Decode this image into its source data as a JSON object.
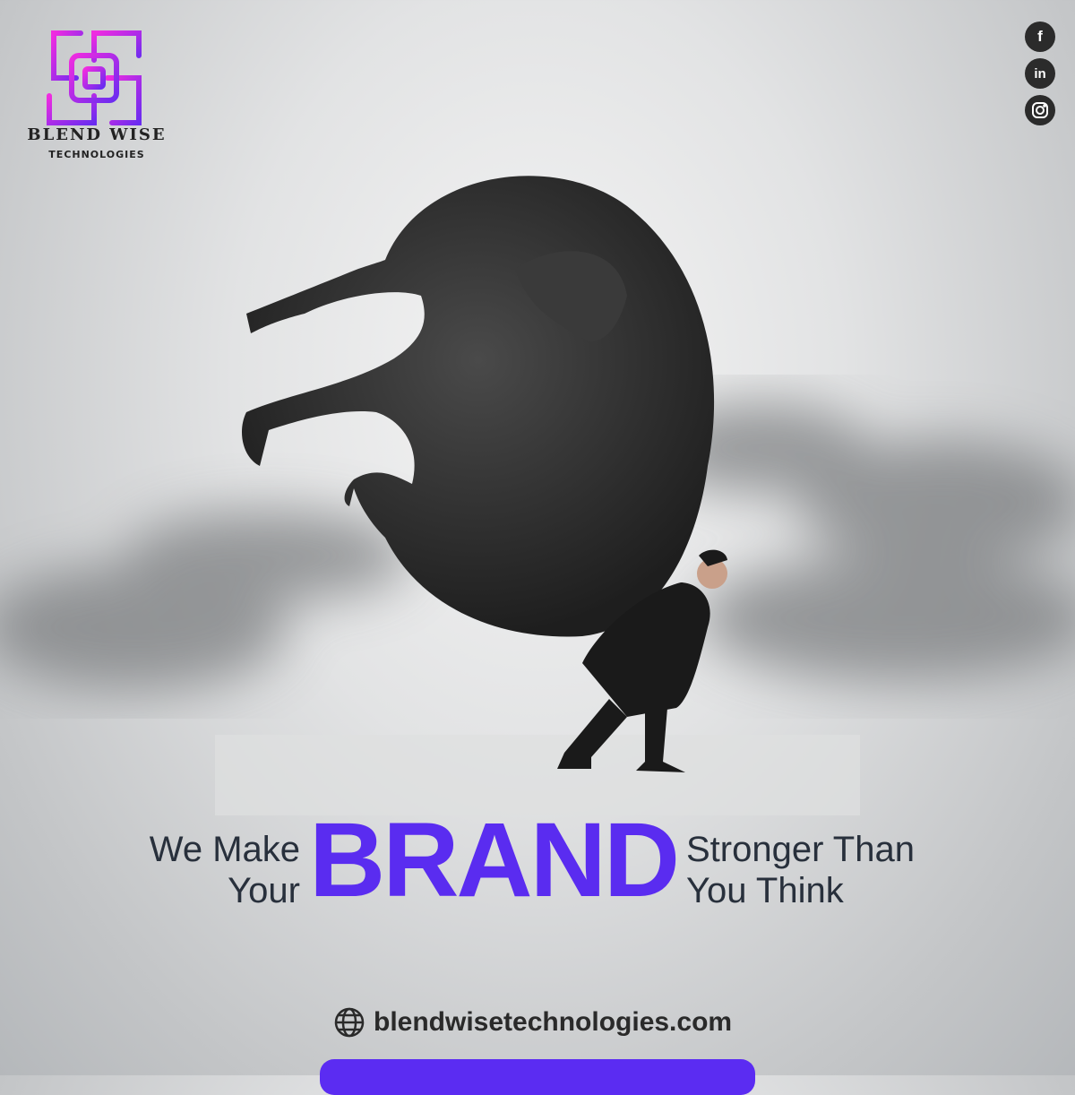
{
  "brand": {
    "name": "BLEND WISE",
    "subtitle": "TECHNOLOGIES"
  },
  "social": [
    {
      "icon": "facebook-icon",
      "glyph": "f"
    },
    {
      "icon": "linkedin-icon",
      "glyph": "in"
    },
    {
      "icon": "instagram-icon",
      "glyph": ""
    }
  ],
  "headline": {
    "left_line1": "We Make",
    "left_line2": "Your",
    "highlight": "BRAND",
    "right_line1": "Stronger Than",
    "right_line2": "You Think"
  },
  "website": {
    "icon": "globe-icon",
    "text": "blendwisetechnologies.com"
  },
  "colors": {
    "accent": "#5a2cf0",
    "logo_pink": "#f02ce0",
    "text": "#28303c"
  }
}
